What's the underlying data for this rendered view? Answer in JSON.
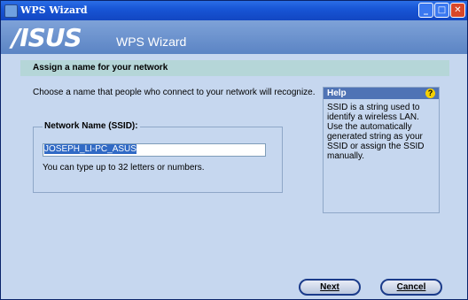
{
  "window": {
    "title": "WPS Wizard"
  },
  "header": {
    "logo": "/ISUS",
    "title": "WPS Wizard"
  },
  "section": {
    "heading": "Assign a name for your network"
  },
  "prompt": "Choose a name that people who connect to your network will recognize.",
  "ssid": {
    "label": "Network Name (SSID):",
    "value": "JOSEPH_LI-PC_ASUS",
    "hint": "You can type up to 32 letters or numbers."
  },
  "help": {
    "title": "Help",
    "text": "SSID is a string used to identify a wireless LAN. Use the automatically generated string as your SSID or assign the SSID manually."
  },
  "buttons": {
    "next": "Next",
    "cancel": "Cancel"
  }
}
